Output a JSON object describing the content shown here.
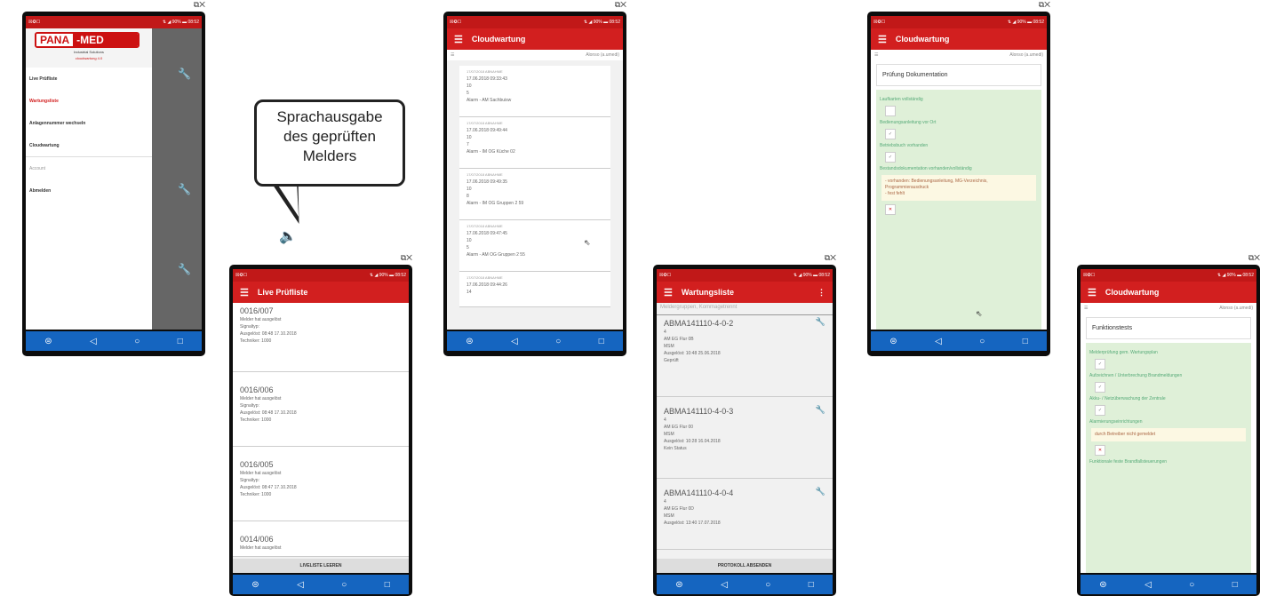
{
  "status": {
    "left": "☒✪☐",
    "right": "⇅ ◢ 90% ▬ 08:52"
  },
  "winctl": "⧉✕",
  "nav": {
    "home": "⊜",
    "back": "◁",
    "circle": "○",
    "square": "□"
  },
  "drawer": {
    "brand_a": "PANA",
    "brand_b": "-MED",
    "brand_sub": "Industrial Solutions",
    "brand_sub2": "cloudwartung 4.0",
    "items": [
      "Live Prüfliste",
      "Wartungsliste",
      "Anlagennummer wechseln",
      "Cloudwartung",
      "Account",
      "Abmelden"
    ]
  },
  "bubble": {
    "line1": "Sprachausgabe",
    "line2": "des geprüften",
    "line3": "Melders"
  },
  "live": {
    "title": "Live Prüfliste",
    "items": [
      {
        "id": "0016/007",
        "l1": "Melder hat ausgelöst",
        "l2": "Signaltyp:",
        "l3": "Ausgelöst: 08:48 17.10.2018",
        "l4": "Techniker: 1000"
      },
      {
        "id": "0016/006",
        "l1": "Melder hat ausgelöst",
        "l2": "Signaltyp:",
        "l3": "Ausgelöst: 08:48 17.10.2018",
        "l4": "Techniker: 1000"
      },
      {
        "id": "0016/005",
        "l1": "Melder hat ausgelöst",
        "l2": "Signaltyp:",
        "l3": "Ausgelöst: 08:47 17.10.2018",
        "l4": "Techniker: 1000"
      },
      {
        "id": "0014/006",
        "l1": "Melder hat ausgelöst",
        "l2": "",
        "l3": "",
        "l4": ""
      }
    ],
    "button": "LIVELISTE LEEREN"
  },
  "cloud1": {
    "title": "Cloudwartung",
    "sub": "Alonso (a.umedi)",
    "items": [
      {
        "top": "17/07/2018 ABNAHME",
        "a": "17.06.2018 09:33:43",
        "b": "10",
        "c": "5",
        "d": "Alarm - AM Sachbuisw"
      },
      {
        "top": "17/07/2018 ABNAHME",
        "a": "17.06.2018 09:49:44",
        "b": "10",
        "c": "7",
        "d": "Alarm - IM OG Küche 02"
      },
      {
        "top": "17/07/2018 ABNAHME",
        "a": "17.06.2018 09:49:35",
        "b": "10",
        "c": "8",
        "d": "Alarm - IM OG Gruppen 2 59"
      },
      {
        "top": "17/07/2018 ABNAHME",
        "a": "17.06.2018 09:47:45",
        "b": "10",
        "c": "5",
        "d": "Alarm - AM OG Gruppen 2 55"
      },
      {
        "top": "17/07/2018 ABNAHME",
        "a": "17.06.2018 09:44:26",
        "b": "14",
        "c": "",
        "d": ""
      }
    ]
  },
  "wartung": {
    "title": "Wartungsliste",
    "search": "Meldergruppen, Kommagetrennt",
    "items": [
      {
        "id": "ABMA141110-4-0-2",
        "l1": "4",
        "l2": "AM EG Flur 0B",
        "l3": "MSM",
        "l4": "Ausgelöst: 10:48 25.06.2018",
        "l5": "Geprüft"
      },
      {
        "id": "ABMA141110-4-0-3",
        "l1": "4",
        "l2": "AM EG Flur 00",
        "l3": "MSM",
        "l4": "Ausgelöst: 10:28 16.04.2018",
        "l5": "Kein Status"
      },
      {
        "id": "ABMA141110-4-0-4",
        "l1": "4",
        "l2": "AM EG Flur 0D",
        "l3": "MSM",
        "l4": "Ausgelöst: 13:40 17.07.2018",
        "l5": ""
      }
    ],
    "button": "PROTOKOLL ABSENDEN"
  },
  "cloud2": {
    "title": "Cloudwartung",
    "sub": "Alonso (a.umedi)",
    "section": "Prüfung Dokumentation",
    "q1": "Laufkarten vollständig",
    "q2": "Bedienungsanleitung vor Ort",
    "q3": "Betriebsbuch vorhanden",
    "q4": "Bestandsdokumentation vorhanden/vollständig",
    "note": "- vorhanden: Bedienungsanleitung, MG-Verzeichnis, Programmierausdruck\n- fest fehlt",
    "chk": "✓",
    "chk_no": "✕"
  },
  "cloud3": {
    "title": "Cloudwartung",
    "sub": "Alonso (a.umedi)",
    "section": "Funktionstests",
    "q1": "Melderprüfung gem. Wartungsplan",
    "q2": "Aufzeichnen / Unterbrechung Brandmeldungen",
    "q3": "Akku- / Netzüberwachung der Zentrale",
    "q4": "Alarmierungseinrichtungen",
    "note": "durch Betreiber nicht gemeldet",
    "q5": "Funktionale feste Brandfallsteuerungen",
    "chk": "✓",
    "chk_no": "✕"
  }
}
